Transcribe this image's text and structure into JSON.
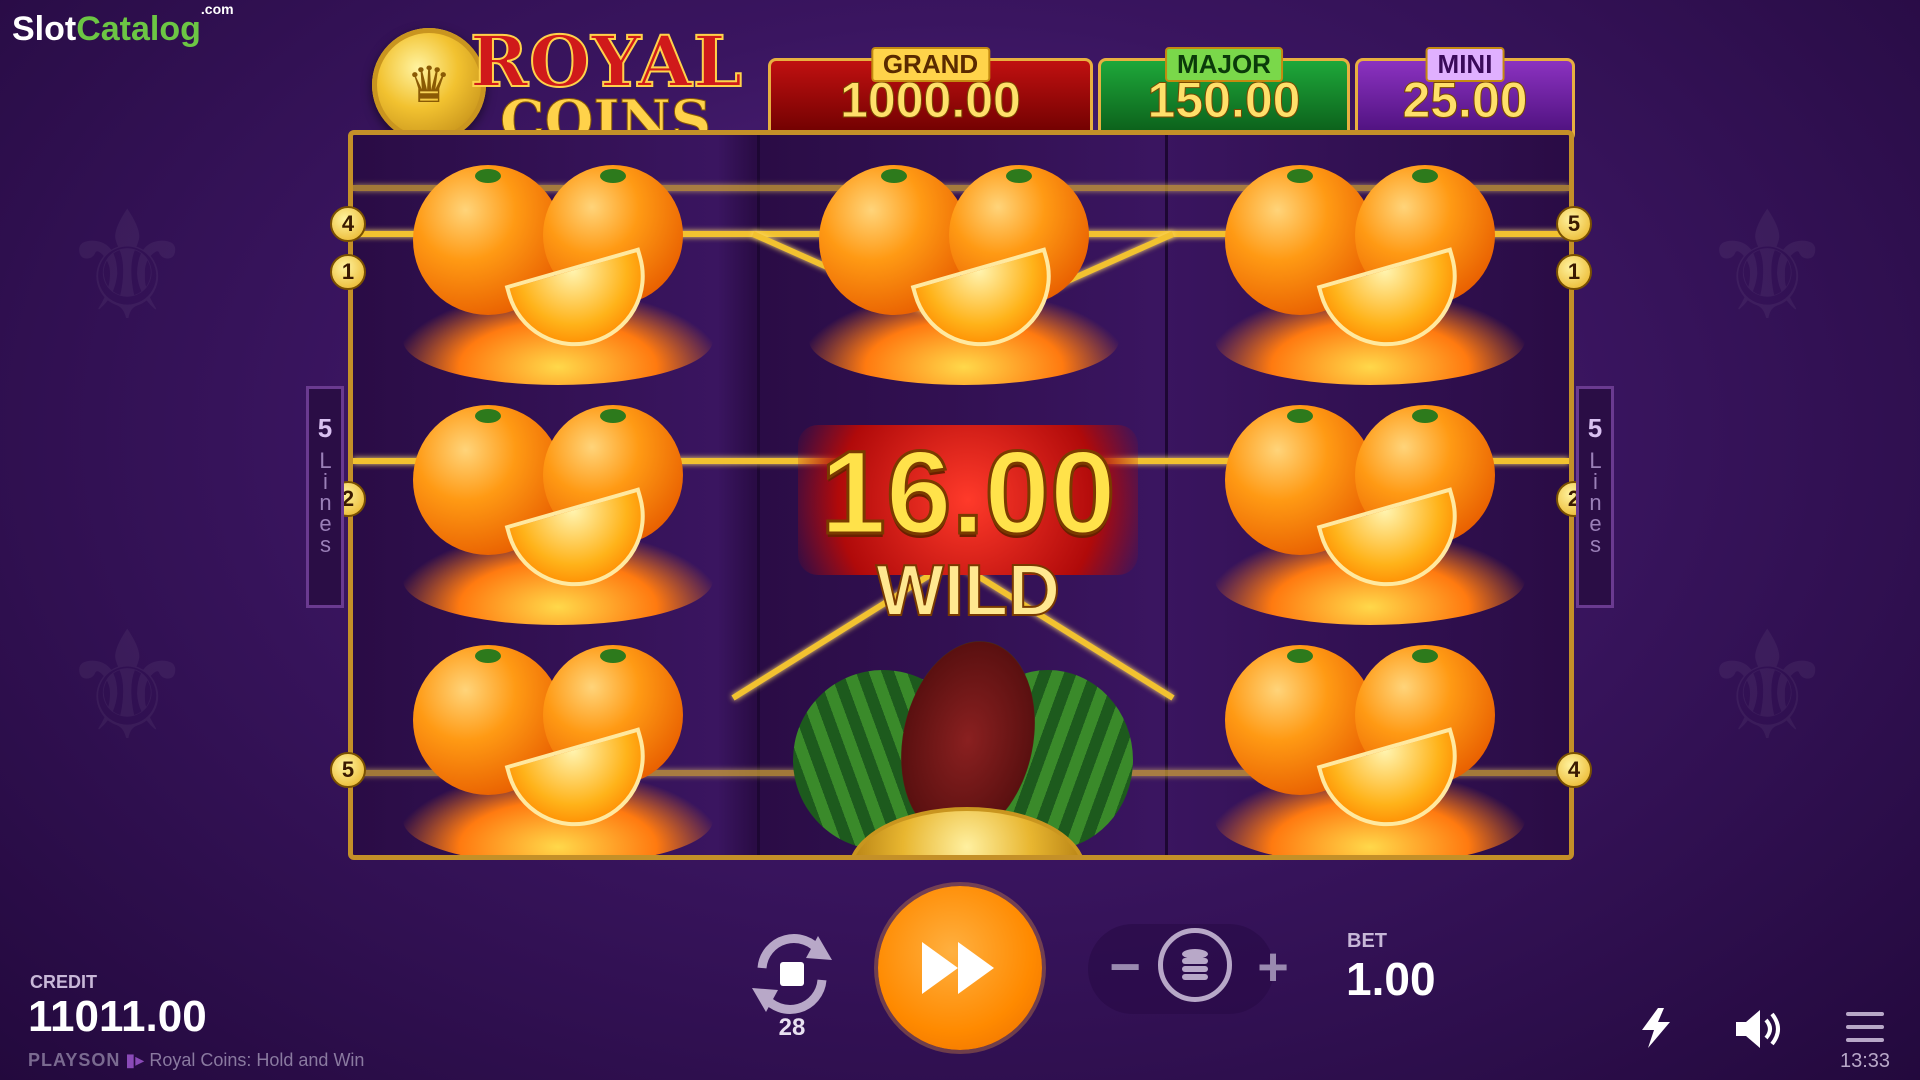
{
  "brand": {
    "name_part1": "Slot",
    "name_part2": "Catalog",
    "suffix": ".com"
  },
  "logo": {
    "line1": "ROYAL",
    "line2": "COINS",
    "icon": "crown-icon"
  },
  "jackpots": [
    {
      "label": "GRAND",
      "value": "1000.00",
      "color": "#c01010"
    },
    {
      "label": "MAJOR",
      "value": "150.00",
      "color": "#1ea83a"
    },
    {
      "label": "MINI",
      "value": "25.00",
      "color": "#8b32c0"
    }
  ],
  "reels": {
    "win_amount": "16.00",
    "wild_label": "WILD",
    "symbols": {
      "reel1": [
        "orange",
        "orange",
        "orange"
      ],
      "reel2": [
        "orange",
        "wild",
        "watermelon"
      ],
      "reel3": [
        "orange",
        "orange",
        "orange"
      ]
    }
  },
  "line_markers": {
    "left": [
      "4",
      "1",
      "2",
      "5"
    ],
    "right": [
      "5",
      "1",
      "2",
      "4"
    ]
  },
  "lines_tab": {
    "count": "5",
    "text": "Lines"
  },
  "credit": {
    "label": "CREDIT",
    "value": "11011.00"
  },
  "footer": {
    "provider": "PLAYSON",
    "game_title": "Royal Coins: Hold and Win"
  },
  "autoplay": {
    "count": "28",
    "icon": "autoplay-stop-icon"
  },
  "spin": {
    "icon": "fast-forward-icon"
  },
  "bet": {
    "label": "BET",
    "value": "1.00",
    "minus": "−",
    "plus": "+"
  },
  "icons": {
    "turbo": "lightning-icon",
    "sound": "speaker-icon",
    "menu": "hamburger-menu-icon"
  },
  "clock": "13:33",
  "colors": {
    "accent": "#ff8a00",
    "frame": "#c49028",
    "background": "#3a1560"
  }
}
